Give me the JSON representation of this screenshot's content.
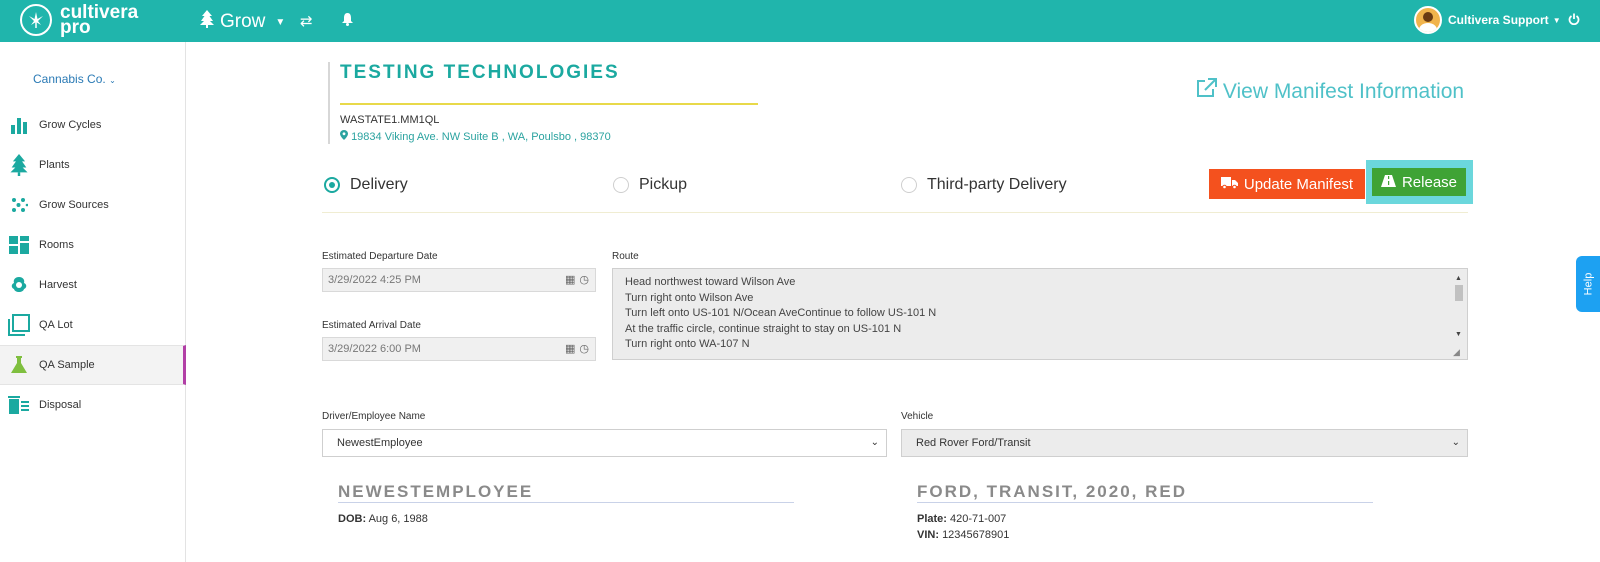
{
  "topbar": {
    "brand_line1": "cultivera",
    "brand_line2": "pro",
    "module": "Grow",
    "user_name": "Cultivera Support"
  },
  "sidebar": {
    "company": "Cannabis Co.",
    "items": [
      {
        "label": "Grow Cycles",
        "icon": "bar-chart-icon"
      },
      {
        "label": "Plants",
        "icon": "tree-icon"
      },
      {
        "label": "Grow Sources",
        "icon": "seeds-icon"
      },
      {
        "label": "Rooms",
        "icon": "rooms-icon"
      },
      {
        "label": "Harvest",
        "icon": "harvest-icon"
      },
      {
        "label": "QA Lot",
        "icon": "qa-lot-icon"
      },
      {
        "label": "QA Sample",
        "icon": "flask-icon"
      },
      {
        "label": "Disposal",
        "icon": "disposal-icon"
      }
    ],
    "active_item": "QA Sample"
  },
  "main": {
    "company_name": "TESTING TECHNOLOGIES",
    "license": "WASTATE1.MM1QL",
    "address": "19834 Viking Ave. NW Suite B , WA, Poulsbo , 98370",
    "view_manifest": "View Manifest Information",
    "delivery_options": [
      {
        "label": "Delivery",
        "selected": true
      },
      {
        "label": "Pickup",
        "selected": false
      },
      {
        "label": "Third-party Delivery",
        "selected": false
      }
    ],
    "update_manifest_label": "Update Manifest",
    "release_label": "Release",
    "departure_label": "Estimated Departure Date",
    "departure_value": "3/29/2022 4:25 PM",
    "arrival_label": "Estimated Arrival Date",
    "arrival_value": "3/29/2022 6:00 PM",
    "route_label": "Route",
    "route_lines": [
      "Head northwest toward Wilson Ave",
      "Turn right onto Wilson Ave",
      "Turn left onto US-101 N/Ocean AveContinue to follow US-101 N",
      "At the traffic circle, continue straight to stay on US-101 N",
      "Turn right onto WA-107 N"
    ],
    "driver_label": "Driver/Employee Name",
    "driver_value": "NewestEmployee",
    "vehicle_label": "Vehicle",
    "vehicle_value": "Red Rover Ford/Transit",
    "driver_card": {
      "title": "NEWESTEMPLOYEE",
      "dob_label": "DOB:",
      "dob_value": "Aug 6, 1988"
    },
    "vehicle_card": {
      "title": "FORD, TRANSIT, 2020, RED",
      "plate_label": "Plate:",
      "plate_value": "420-71-007",
      "vin_label": "VIN:",
      "vin_value": "12345678901"
    }
  },
  "help_label": "Help",
  "colors": {
    "header_teal": "#20b5ac",
    "update_orange": "#f4511e",
    "release_green": "#3fa335",
    "active_marker": "#b23fa6"
  }
}
